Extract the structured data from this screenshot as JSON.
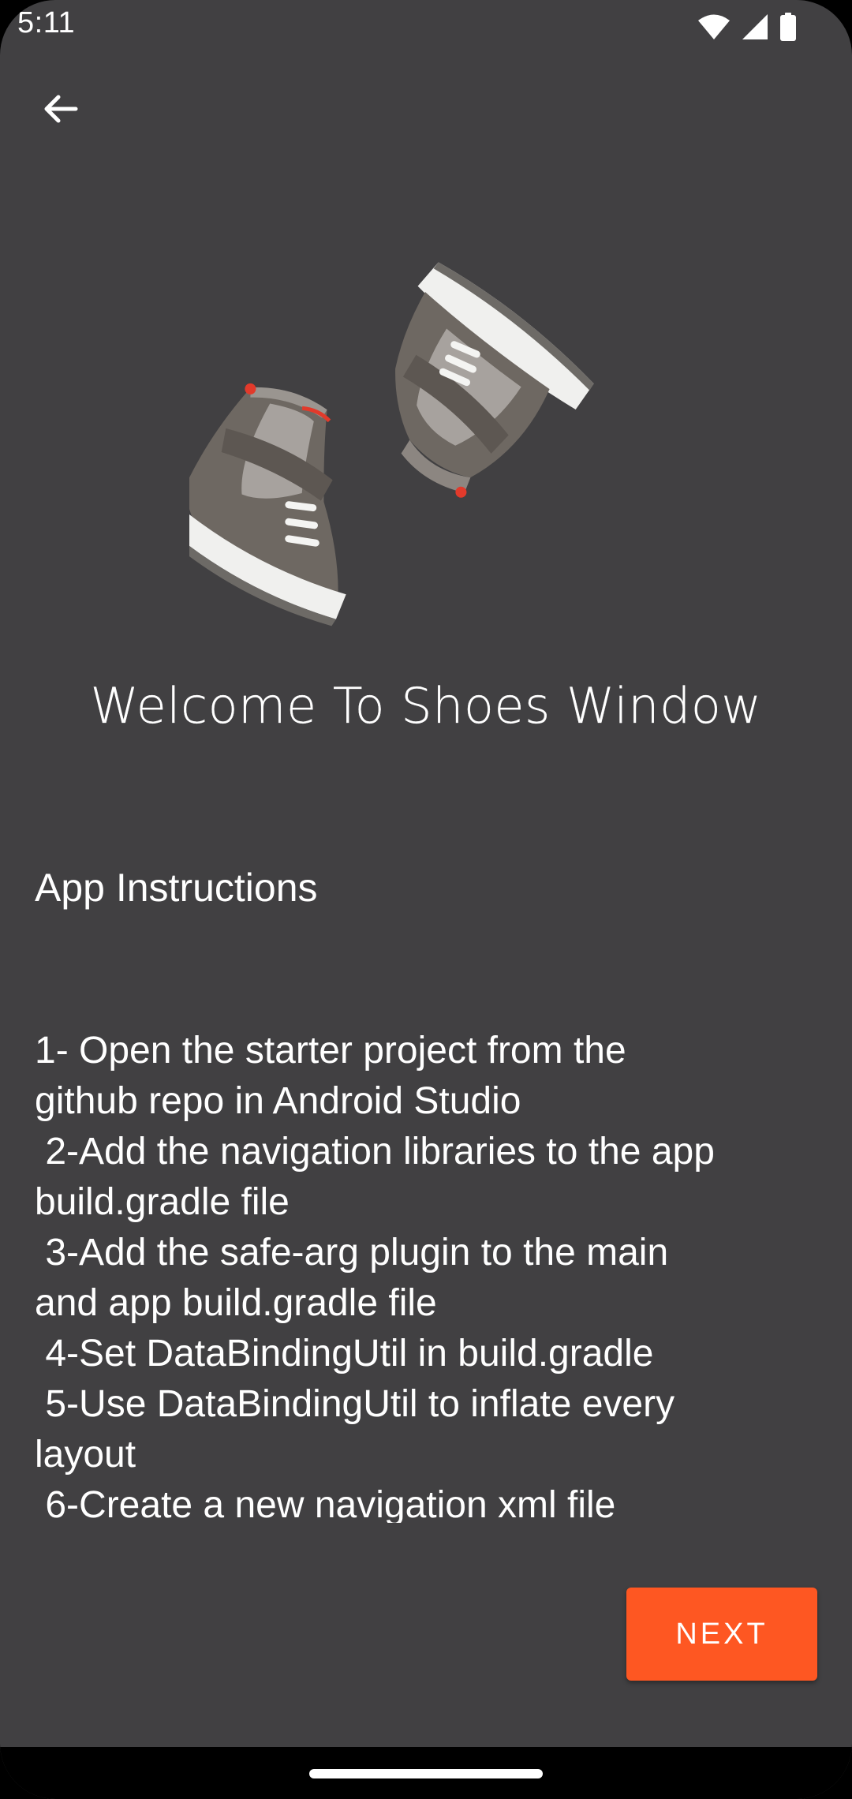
{
  "status_bar": {
    "time": "5:11",
    "icons": [
      "wifi-icon",
      "cellular-signal-icon",
      "battery-icon"
    ]
  },
  "toolbar": {
    "back_icon": "back-arrow-icon"
  },
  "hero": {
    "image": "sneakers-pair-illustration"
  },
  "welcome": {
    "title": "Welcome To Shoes Window"
  },
  "instructions": {
    "heading": "App Instructions",
    "body": "1- Open the starter project from the\ngithub repo in Android Studio\n 2-Add the navigation libraries to the app\nbuild.gradle file\n 3-Add the safe-arg plugin to the main\nand app build.gradle file\n 4-Set DataBindingUtil in build.gradle\n 5-Use DataBindingUtil to inflate every\nlayout\n 6-Create a new navigation xml file"
  },
  "actions": {
    "next_label": "NEXT"
  },
  "colors": {
    "background": "#414042",
    "accent": "#fe5722",
    "text": "#ffffff"
  }
}
